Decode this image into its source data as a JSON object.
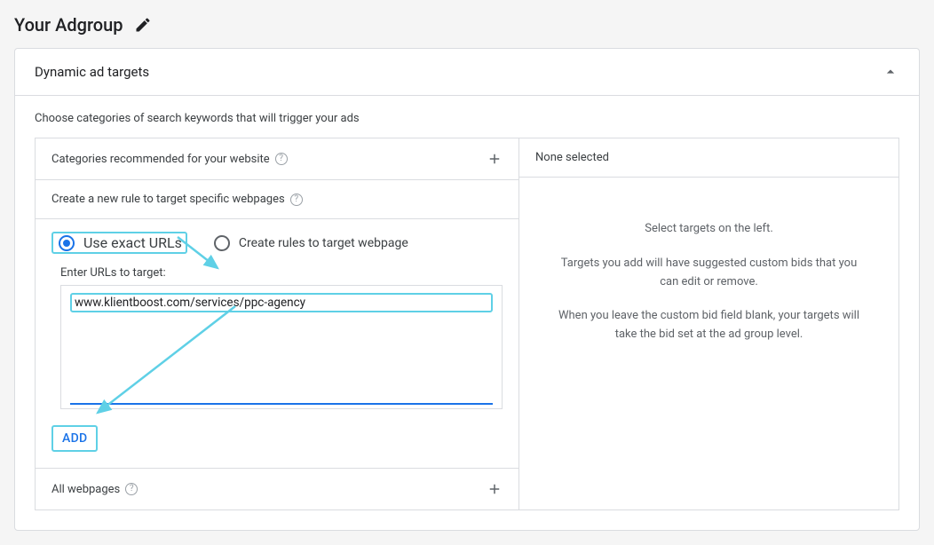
{
  "header": {
    "title": "Your Adgroup"
  },
  "panel": {
    "title": "Dynamic ad targets",
    "intro": "Choose categories of search keywords that will trigger your ads",
    "categories_row": "Categories recommended for your website",
    "create_rule_row": "Create a new rule to target specific webpages",
    "all_webpages_row": "All webpages",
    "radio_exact": "Use exact URLs",
    "radio_rules": "Create rules to target webpage",
    "enter_urls_label": "Enter URLs to target:",
    "url_value": "www.klientboost.com/services/ppc-agency",
    "add_button": "ADD"
  },
  "right": {
    "none_selected": "None selected",
    "line1": "Select targets on the left.",
    "line2": "Targets you add will have suggested custom bids that you can edit or remove.",
    "line3": "When you leave the custom bid field blank, your targets will take the bid set at the ad group level."
  }
}
